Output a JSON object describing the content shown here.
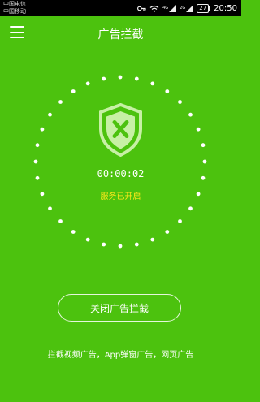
{
  "status_bar": {
    "carrier_1": "中国电信",
    "carrier_2": "中国移动",
    "battery": "27",
    "time": "20:50",
    "network_1": "4G",
    "network_2": "2G"
  },
  "app_bar": {
    "menu_icon": "hamburger-menu-icon",
    "title": "广告拦截"
  },
  "main": {
    "shield_icon": "shield-x-icon",
    "timer": "00:00:02",
    "service_status": "服务已开启",
    "action_button": "关闭广告拦截",
    "footer_text": "拦截视频广告，App弹窗广告，网页广告"
  },
  "colors": {
    "background": "#4cc20e",
    "status_text": "#ffe81a",
    "foreground": "#ffffff"
  }
}
